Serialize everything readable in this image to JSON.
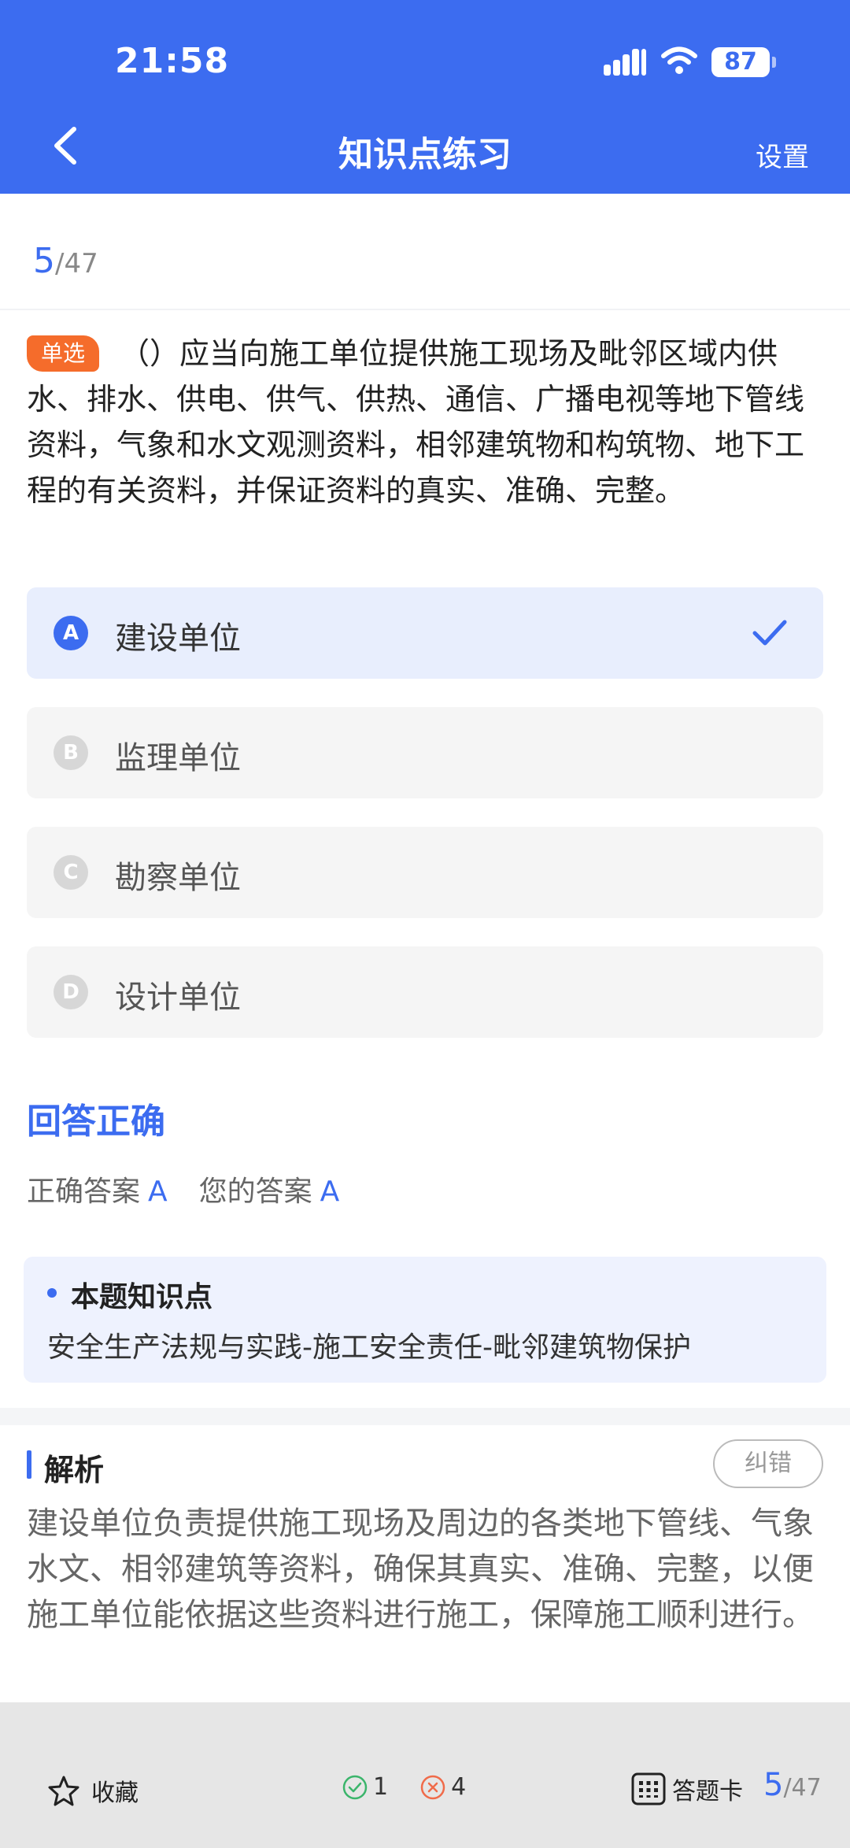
{
  "status_bar": {
    "time": "21:58",
    "battery": "87"
  },
  "nav": {
    "title": "知识点练习",
    "settings": "设置"
  },
  "progress": {
    "current": "5",
    "total": "/47"
  },
  "question": {
    "type": "单选",
    "text": "（）应当向施工单位提供施工现场及毗邻区域内供水、排水、供电、供气、供热、通信、广播电视等地下管线资料，气象和水文观测资料，相邻建筑物和构筑物、地下工程的有关资料，并保证资料的真实、准确、完整。"
  },
  "options": [
    {
      "letter": "A",
      "text": "建设单位",
      "selected": true
    },
    {
      "letter": "B",
      "text": "监理单位",
      "selected": false
    },
    {
      "letter": "C",
      "text": "勘察单位",
      "selected": false
    },
    {
      "letter": "D",
      "text": "设计单位",
      "selected": false
    }
  ],
  "result": {
    "title": "回答正确",
    "correct_label": "正确答案",
    "correct_value": "A",
    "your_label": "您的答案",
    "your_value": "A"
  },
  "knowledge_point": {
    "title": "本题知识点",
    "text": "安全生产法规与实践-施工安全责任-毗邻建筑物保护"
  },
  "analysis": {
    "title": "解析",
    "correct_button": "纠错",
    "text": "建设单位负责提供施工现场及周边的各类地下管线、气象水文、相邻建筑等资料，确保其真实、准确、完整，以便施工单位能依据这些资料进行施工，保障施工顺利进行。"
  },
  "bottom_bar": {
    "favorite_label": "收藏",
    "correct_count": "1",
    "wrong_count": "4",
    "answer_card_label": "答题卡",
    "progress_current": "5",
    "progress_total": "/47"
  },
  "colors": {
    "accent": "#3c6cf0",
    "badge": "#f56c2b",
    "correct": "#3bb56b",
    "wrong": "#f06b4a"
  }
}
